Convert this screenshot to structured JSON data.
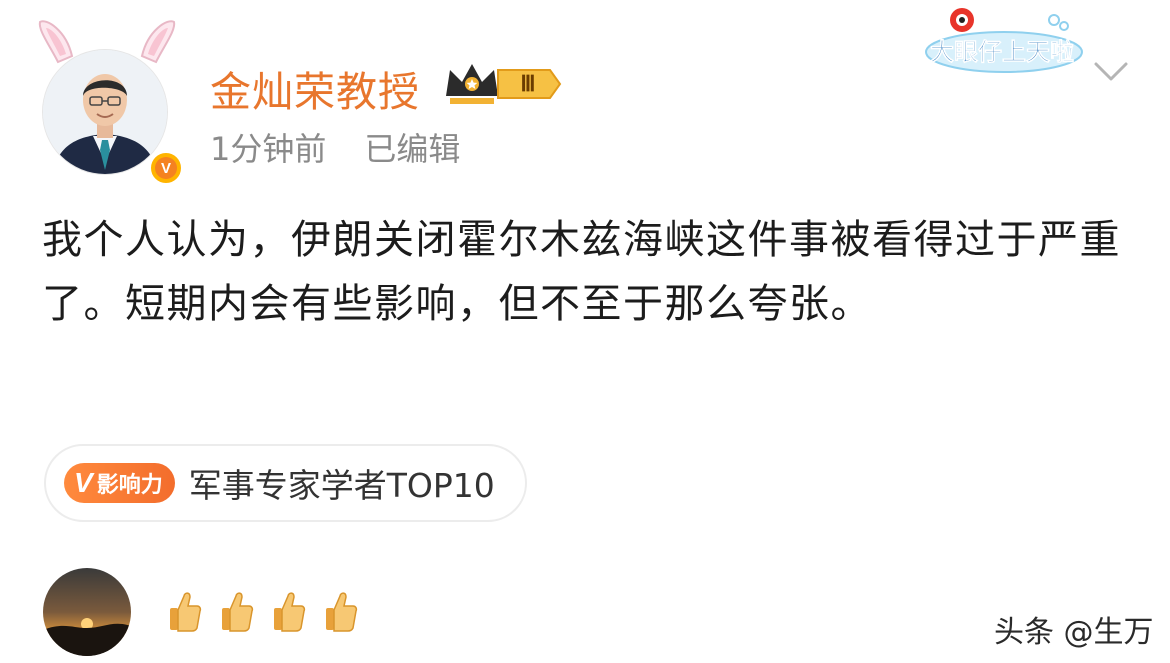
{
  "author": {
    "name": "金灿荣教授",
    "level_badge": "Ⅲ",
    "verified_mark": "V"
  },
  "meta": {
    "time": "1分钟前",
    "edited": "已编辑"
  },
  "campaign": {
    "text": "大眼仔上天啦"
  },
  "post": {
    "text": "我个人认为，伊朗关闭霍尔木兹海峡这件事被看得过于严重了。短期内会有些影响，但不至于那么夸张。"
  },
  "tag": {
    "badge_v": "V",
    "badge_text": "影响力",
    "text": "军事专家学者TOP10"
  },
  "reactions": {
    "count_icons": 4,
    "icon": "thumbs-up-icon"
  },
  "watermark": {
    "text": "头条 @生万"
  },
  "colors": {
    "author_name": "#e8762d",
    "verified": "#ffb400",
    "influence": "#f36d2c",
    "meta": "#8a8a8a"
  },
  "icons": [
    "bunny-ears-icon",
    "verified-icon",
    "crown-level-icon",
    "chevron-down-icon",
    "thumbs-up-icon",
    "campaign-logo-icon"
  ]
}
